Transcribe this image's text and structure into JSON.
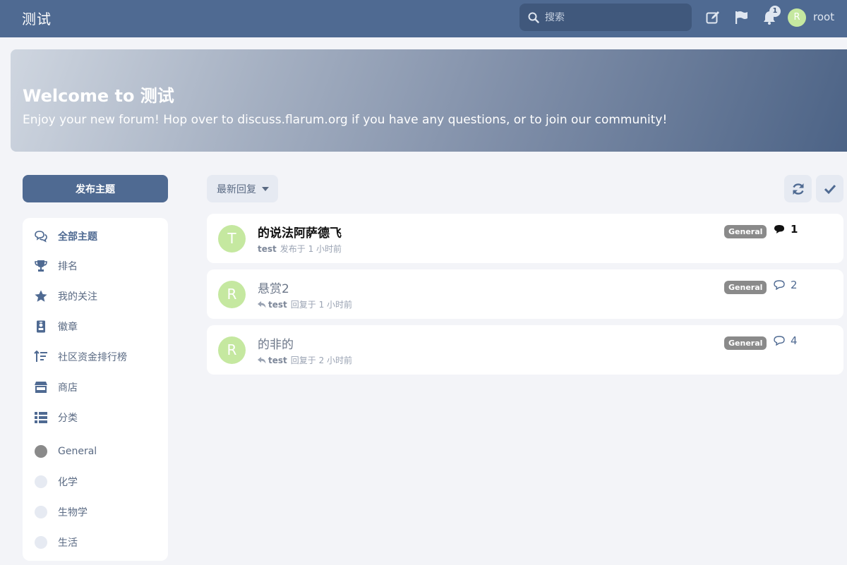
{
  "header": {
    "site_title": "测试",
    "search_placeholder": "搜索",
    "notification_count": "1",
    "user_initial": "R",
    "username": "root"
  },
  "hero": {
    "title": "Welcome to 测试",
    "description": "Enjoy your new forum! Hop over to discuss.flarum.org if you have any questions, or to join our community!"
  },
  "sidebar": {
    "start_button": "发布主题",
    "items": [
      {
        "label": "全部主题",
        "icon": "comments-icon",
        "active": true
      },
      {
        "label": "排名",
        "icon": "trophy-icon"
      },
      {
        "label": "我的关注",
        "icon": "star-icon"
      },
      {
        "label": "徽章",
        "icon": "id-badge-icon"
      },
      {
        "label": "社区资金排行榜",
        "icon": "sort-amount-icon"
      },
      {
        "label": "商店",
        "icon": "store-icon"
      },
      {
        "label": "分类",
        "icon": "list-icon"
      }
    ],
    "tags": [
      {
        "label": "General",
        "color": "#8a8a8a"
      },
      {
        "label": "化学",
        "color": "#e6eaf2"
      },
      {
        "label": "生物学",
        "color": "#e6eaf2"
      },
      {
        "label": "生活",
        "color": "#e6eaf2"
      }
    ]
  },
  "toolbar": {
    "sort_label": "最新回复",
    "refresh_icon": "refresh-icon",
    "mark_read_icon": "check-icon"
  },
  "discussions": [
    {
      "initial": "T",
      "title": "的说法阿萨德飞",
      "author": "test",
      "action": "发布于 1 小时前",
      "tag": "General",
      "count": "1",
      "unread": true,
      "reply": false
    },
    {
      "initial": "R",
      "title": "悬赏2",
      "author": "test",
      "action": "回复于 1 小时前",
      "tag": "General",
      "count": "2",
      "unread": false,
      "reply": true
    },
    {
      "initial": "R",
      "title": "的非的",
      "author": "test",
      "action": "回复于 2 小时前",
      "tag": "General",
      "count": "4",
      "unread": false,
      "reply": true
    }
  ],
  "colors": {
    "header": "#4f6a92",
    "primary": "#4f6a92",
    "avatar": "#c5e8a0",
    "tag_general": "#8a8a8a"
  }
}
